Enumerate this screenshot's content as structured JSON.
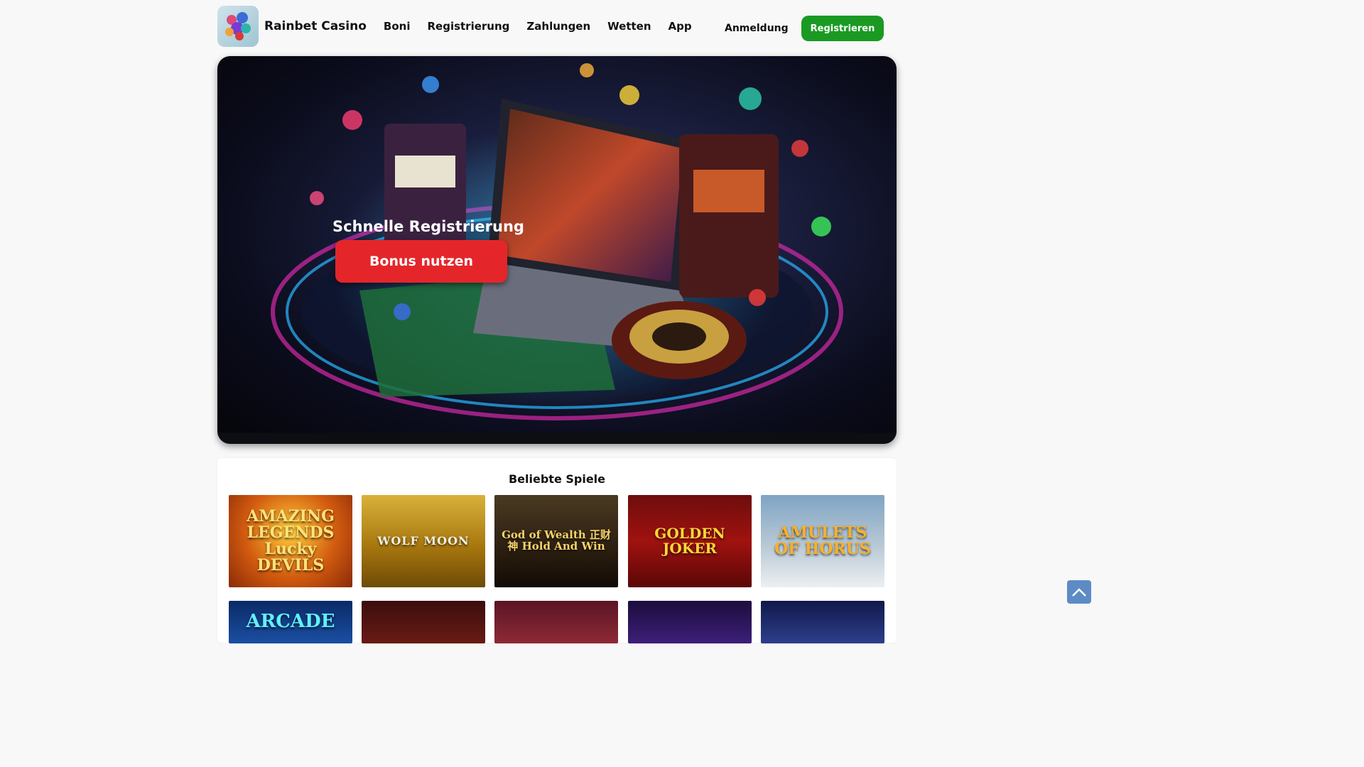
{
  "header": {
    "brand": "Rainbet Casino",
    "nav": [
      "Boni",
      "Registrierung",
      "Zahlungen",
      "Wetten",
      "App"
    ],
    "login_label": "Anmeldung",
    "register_label": "Registrieren"
  },
  "hero": {
    "title": "Schnelle Registrierung",
    "cta_label": "Bonus nutzen"
  },
  "games": {
    "title": "Beliebte Spiele",
    "tiles": [
      {
        "name": "AMAZING LEGENDS Lucky DEVILS"
      },
      {
        "name": "WOLF MOON"
      },
      {
        "name": "God of Wealth 正财神 Hold And Win"
      },
      {
        "name": "GOLDEN JOKER"
      },
      {
        "name": "AMULETS OF HORUS"
      },
      {
        "name": "ARCADE"
      }
    ]
  },
  "colors": {
    "register_green": "#1a9a23",
    "cta_red": "#e4262b",
    "scroll_top_blue": "#5d8cc4"
  },
  "icons": {
    "scroll_top": "chevron-up-icon"
  }
}
